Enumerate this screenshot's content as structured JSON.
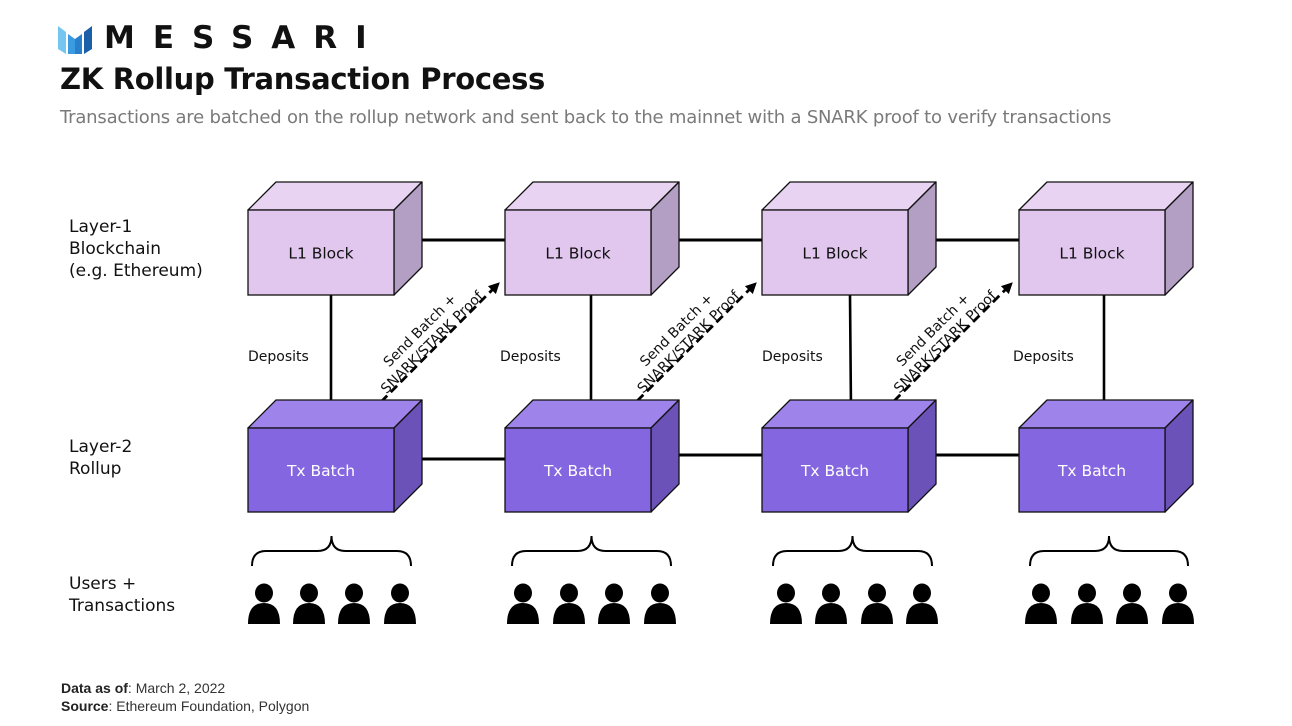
{
  "brand": {
    "name": "MESSARI",
    "logo_icon": "messari-m-logo-icon",
    "logo_colors": [
      "#6cc4f0",
      "#2e8fd6",
      "#1a5fa8"
    ]
  },
  "header": {
    "title": "ZK Rollup Transaction Process",
    "subtitle": "Transactions are batched on the rollup network and sent back to the mainnet with a SNARK proof to verify transactions"
  },
  "row_labels": {
    "layer1": "Layer-1\nBlockchain\n(e.g. Ethereum)",
    "layer2": "Layer-2\nRollup",
    "users": "Users +\nTransactions"
  },
  "diagram": {
    "l1_blocks": [
      {
        "label": "L1 Block"
      },
      {
        "label": "L1 Block"
      },
      {
        "label": "L1 Block"
      },
      {
        "label": "L1 Block"
      }
    ],
    "tx_batches": [
      {
        "label": "Tx Batch"
      },
      {
        "label": "Tx Batch"
      },
      {
        "label": "Tx Batch"
      },
      {
        "label": "Tx Batch"
      }
    ],
    "deposit_label": "Deposits",
    "proof_label_line1": "Send Batch +",
    "proof_label_line2": "SNARK/STARK Proof",
    "users_per_group": 4,
    "colors": {
      "l1_front": "#e1c7ee",
      "l1_top": "#e8d3f2",
      "l1_side": "#b39fc3",
      "l2_front": "#8466e0",
      "l2_top": "#9e84ea",
      "l2_side": "#6a52b8",
      "l1_text": "#111111",
      "l2_text": "#ffffff"
    }
  },
  "footer": {
    "data_as_of_label": "Data as of",
    "data_as_of_value": ": March 2, 2022",
    "source_label": "Source",
    "source_value": ": Ethereum Foundation, Polygon"
  }
}
